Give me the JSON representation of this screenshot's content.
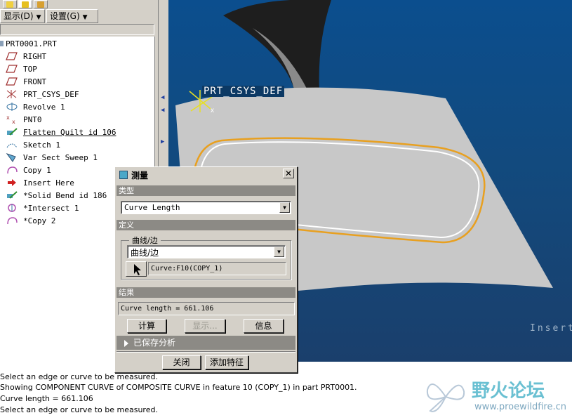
{
  "left_panel": {
    "menus": [
      {
        "label": "显示(D)"
      },
      {
        "label": "设置(G)"
      }
    ],
    "model_tree": [
      {
        "label": "PRT0001.PRT",
        "icon": "part-icon"
      },
      {
        "label": "RIGHT",
        "icon": "datum-plane-icon"
      },
      {
        "label": "TOP",
        "icon": "datum-plane-icon"
      },
      {
        "label": "FRONT",
        "icon": "datum-plane-icon"
      },
      {
        "label": "PRT_CSYS_DEF",
        "icon": "csys-icon"
      },
      {
        "label": "Revolve 1",
        "icon": "revolve-icon"
      },
      {
        "label": "PNT0",
        "icon": "datum-point-icon"
      },
      {
        "label": "Flatten Quilt id 106",
        "icon": "flatten-quilt-icon"
      },
      {
        "label": "Sketch 1",
        "icon": "sketch-icon"
      },
      {
        "label": "Var Sect Sweep 1",
        "icon": "sweep-icon"
      },
      {
        "label": "Copy 1",
        "icon": "copy-icon"
      },
      {
        "label": "Insert Here",
        "icon": "insert-arrow-icon"
      },
      {
        "label": "*Solid Bend id 186",
        "icon": "solid-bend-icon"
      },
      {
        "label": "*Intersect 1",
        "icon": "intersect-icon"
      },
      {
        "label": "*Copy 2",
        "icon": "copy-icon"
      }
    ]
  },
  "viewport": {
    "csys_label": "PRT_CSYS_DEF",
    "watermark": "Insert"
  },
  "dialog": {
    "title": "测量",
    "type_section": "类型",
    "type_value": "Curve Length",
    "definition_section": "定义",
    "group_label": "曲线/边",
    "curve_dropdown_value": "曲线/边",
    "selection_value": "Curve:F10(COPY_1)",
    "results_section": "结果",
    "result_value": "Curve length = 661.106",
    "compute_button": "计算",
    "display_button": "显示...",
    "info_button": "信息",
    "saved_analysis": "已保存分析",
    "close_button": "关闭",
    "add_feature_button": "添加特征"
  },
  "messages": [
    "Select an edge or curve to be measured.",
    "Showing COMPONENT CURVE of COMPOSITE CURVE in feature 10 (COPY_1) in part PRT0001.",
    "Curve length = 661.106",
    "Select an edge or curve to be measured."
  ],
  "forum": {
    "name": "野火论坛",
    "url": "www.proewildfire.cn"
  },
  "colors": {
    "viewport_bg": "#124a7e",
    "surface": "#c8c8c8",
    "highlight_curve": "#e8a020",
    "section_header": "#8c8a85"
  }
}
